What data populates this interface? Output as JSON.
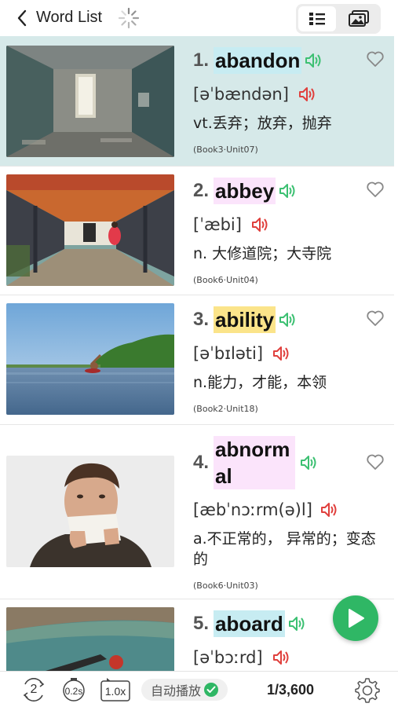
{
  "header": {
    "title": "Word List"
  },
  "colors": {
    "accent_green": "#2fb765",
    "active_row": "#d6e9e9",
    "speaker_red": "#e0403d"
  },
  "words": [
    {
      "num": "1.",
      "word": "abandon",
      "phonetic": "[əˈbændən]",
      "meaning": "vt.丢弃；放弃，抛弃",
      "book": "(Book3·Unit07)",
      "highlight": "cyan",
      "active": true
    },
    {
      "num": "2.",
      "word": "abbey",
      "phonetic": "[ˈæbi]",
      "meaning": "n. 大修道院；大寺院",
      "book": "(Book6·Unit04)",
      "highlight": "pink",
      "active": false
    },
    {
      "num": "3.",
      "word": "ability",
      "phonetic": "[əˈbɪləti]",
      "meaning": "n.能力，才能，本领",
      "book": "(Book2·Unit18)",
      "highlight": "yellow",
      "active": false
    },
    {
      "num": "4.",
      "word_line1": "abnorm",
      "word_line2": "al",
      "phonetic": "[æbˈnɔːrm(ə)l]",
      "meaning": "a.不正常的， 异常的；变态的",
      "book": "(Book6·Unit03)",
      "highlight": "pink",
      "active": false
    },
    {
      "num": "5.",
      "word": "aboard",
      "phonetic": "[əˈbɔːrd]",
      "highlight": "cyan",
      "active": false
    }
  ],
  "bottom_bar": {
    "repeat_count": "2",
    "interval": "0.2s",
    "speed": "1.0x",
    "autoplay_label": "自动播放",
    "counter": "1/3,600"
  }
}
